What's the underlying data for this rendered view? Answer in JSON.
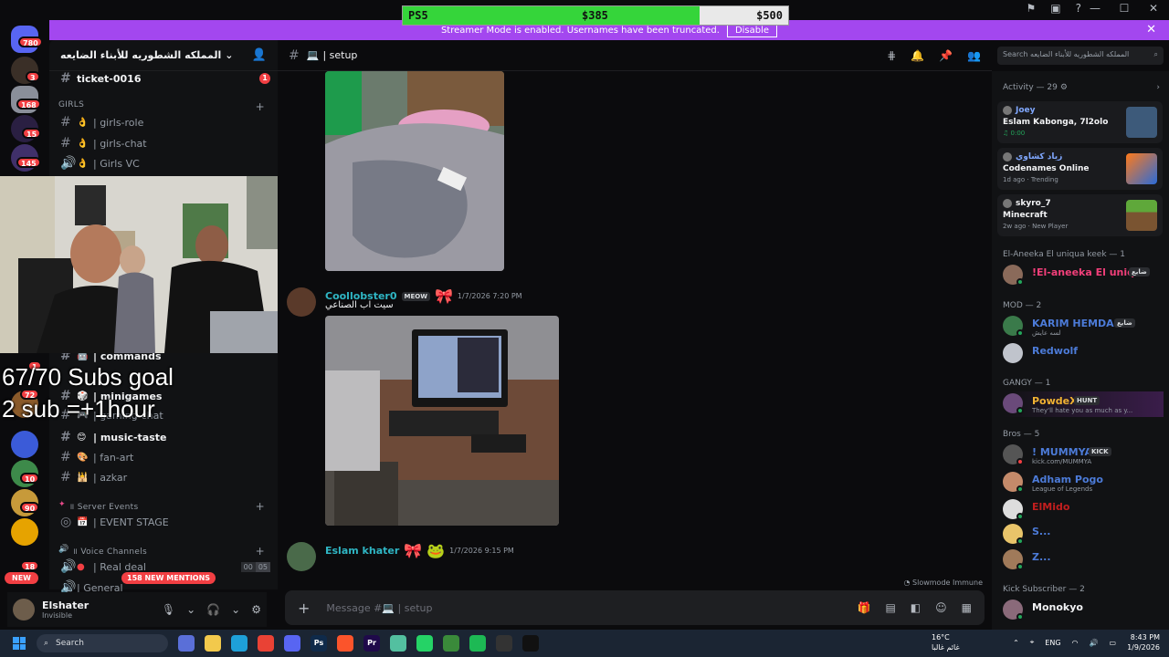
{
  "donation": {
    "label": "PS5",
    "current": "$385",
    "goal": "$500",
    "progress": 0.77
  },
  "banner": {
    "text": "Streamer Mode is enabled. Usernames have been truncated.",
    "disable_label": "Disable"
  },
  "rail": {
    "badges": [
      "780",
      "3",
      "168",
      "15",
      "145",
      "1",
      "72",
      "10",
      "90",
      "18"
    ],
    "new_label": "NEW"
  },
  "server": {
    "name": "المملكه الشطوريه للأبناء الضايعه"
  },
  "channels": {
    "ticket": "ticket-0016",
    "ticket_count": "1",
    "category_girls": "GIRLS",
    "girls_role": "| girls-role",
    "girls_chat": "| girls-chat",
    "girls_vc": "| Girls VC",
    "commands": "| commands",
    "minigames": "| minigames",
    "gaming_chat": "| gaming-chat",
    "music_taste": "| music-taste",
    "fan_art": "| fan-art",
    "azkar": "| azkar",
    "category_events": "॥ Server Events",
    "event_stage": "| EVENT STAGE",
    "category_voice": "॥ Voice Channels",
    "real_deal": "| Real deal",
    "real_deal_count_a": "00",
    "real_deal_count_b": "05",
    "general": "| General"
  },
  "overlay": {
    "goal_line1": "67/70 Subs goal",
    "goal_line2": "2 sub =+1hour"
  },
  "mentions_pill": "158 NEW MENTIONS",
  "user": {
    "name": "Elshater",
    "status": "Invisible"
  },
  "chat": {
    "channel": "| setup",
    "messages": [
      {
        "author": "Coollobster0",
        "tag": "MEOW",
        "time": "1/7/2026 7:20 PM",
        "text": "سيت اب الصناعي"
      },
      {
        "author": "Eslam khater",
        "tag": "",
        "time": "1/7/2026 9:15 PM",
        "text": ""
      }
    ],
    "slowmode": "Slowmode Immune",
    "composer_placeholder": "Message #💻 | setup"
  },
  "search": {
    "placeholder": "Search المملكه الشطوريه للأبناء الضايعه"
  },
  "activity": {
    "title": "Activity — 29",
    "cards": [
      {
        "user": "Joey",
        "game": "Eslam Kabonga, 7l2olo",
        "meta": "♫ 0:00"
      },
      {
        "user": "زياد كشاوي",
        "game": "Codenames Online",
        "meta": "1d ago · Trending"
      },
      {
        "user": "skyro_7",
        "game": "Minecraft",
        "meta": "2w ago · New Player"
      }
    ]
  },
  "member_groups": {
    "aneeka": "El-Aneeka El uniqua keek — 1",
    "mod": "MOD — 2",
    "gangy": "GANGY — 1",
    "bros": "Bros — 5",
    "kick": "Kick Subscriber — 2"
  },
  "members": [
    {
      "name": "!El-aneeka El uniq...",
      "tag": "ضايع",
      "sub": "",
      "color": "#f23f7a"
    },
    {
      "name": "KARIM HEMDAN",
      "tag": "ضايع",
      "sub": "لسه عايش",
      "color": "#4c7bd8"
    },
    {
      "name": "Redwolf",
      "tag": "",
      "sub": "",
      "color": "#4c7bd8"
    },
    {
      "name": "PowdeX",
      "tag": "HUNT",
      "sub": "They'll hate you as much as y...",
      "color": "#f0b232"
    },
    {
      "name": "! MUMMYA",
      "tag": "KICK",
      "sub": "kick.com/MUMMYA",
      "color": "#4c7bd8"
    },
    {
      "name": "Adham Pogo",
      "tag": "",
      "sub": "League of Legends",
      "color": "#4c7bd8"
    },
    {
      "name": "ElMido",
      "tag": "",
      "sub": "",
      "color": "#c21e1e"
    },
    {
      "name": "S...",
      "tag": "",
      "sub": "",
      "color": "#4c7bd8"
    },
    {
      "name": "Z...",
      "tag": "",
      "sub": "",
      "color": "#4c7bd8"
    },
    {
      "name": "Monokyo",
      "tag": "",
      "sub": "",
      "color": "#f2f3f5"
    }
  ],
  "taskbar": {
    "search_label": "Search",
    "weather_temp": "16°C",
    "weather_desc": "غائم غالبا",
    "lang": "ENG",
    "time": "8:43 PM",
    "date": "1/9/2026"
  },
  "colors": {
    "accent": "#5865f2",
    "banner": "#a347ef",
    "mention": "#f23f43",
    "online": "#23a55a"
  }
}
